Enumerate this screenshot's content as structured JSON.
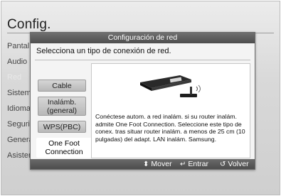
{
  "screen": {
    "title": "Config.",
    "menu_items": [
      {
        "label": "Pantalla"
      },
      {
        "label": "Audio"
      },
      {
        "label": "Red"
      },
      {
        "label": "Sistema"
      },
      {
        "label": "Idioma"
      },
      {
        "label": "Seguridad"
      },
      {
        "label": "General"
      },
      {
        "label": "Asistencia"
      }
    ]
  },
  "dialog": {
    "title": "Configuración de red",
    "subtitle": "Selecciona un tipo de conexión de red.",
    "options": [
      {
        "label": "Cable"
      },
      {
        "label": "Inalámb. (general)"
      },
      {
        "label": "WPS(PBC)"
      },
      {
        "label": "One Foot Connection",
        "selected": true
      }
    ],
    "description": "Conéctese autom. a red inalám. si su router inalám. admite One Foot Connection. Seleccione este tipo de conex. tras situar router inalám. a menos de 25 cm (10 pulgadas) del adapt. LAN inalám. Samsung.",
    "illustration_icon": "wireless-router-icon"
  },
  "footer": {
    "move_label": "Mover",
    "enter_label": "Entrar",
    "back_label": "Volver"
  }
}
